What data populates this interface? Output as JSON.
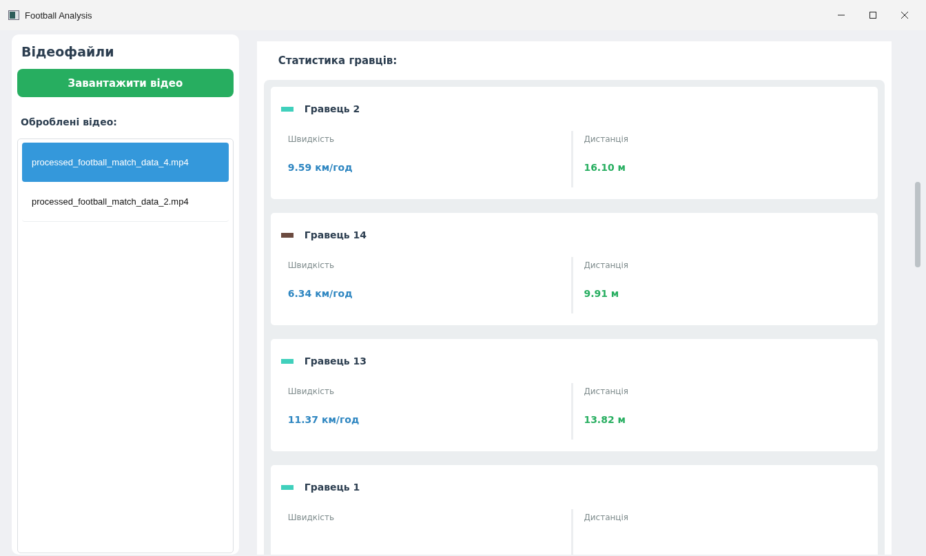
{
  "window": {
    "title": "Football Analysis"
  },
  "sidebar": {
    "title": "Відеофайли",
    "upload_button": "Завантажити відео",
    "list_title": "Оброблені відео:",
    "videos": [
      {
        "name": "processed_football_match_data_4.mp4",
        "selected": true
      },
      {
        "name": "processed_football_match_data_2.mp4",
        "selected": false
      }
    ]
  },
  "stats": {
    "title": "Статистика гравців:",
    "players": [
      {
        "name": "Гравець 2",
        "color": "#40d0bc",
        "speed_label": "Швидкість",
        "speed": "9.59 км/год",
        "distance_label": "Дистанція",
        "distance": "16.10 м"
      },
      {
        "name": "Гравець 14",
        "color": "#6b4a3f",
        "speed_label": "Швидкість",
        "speed": "6.34 км/год",
        "distance_label": "Дистанція",
        "distance": "9.91 м"
      },
      {
        "name": "Гравець 13",
        "color": "#40d0bc",
        "speed_label": "Швидкість",
        "speed": "11.37 км/год",
        "distance_label": "Дистанція",
        "distance": "13.82 м"
      },
      {
        "name": "Гравець 1",
        "color": "#40d0bc",
        "speed_label": "Швидкість",
        "distance_label": "Дистанція"
      }
    ]
  }
}
